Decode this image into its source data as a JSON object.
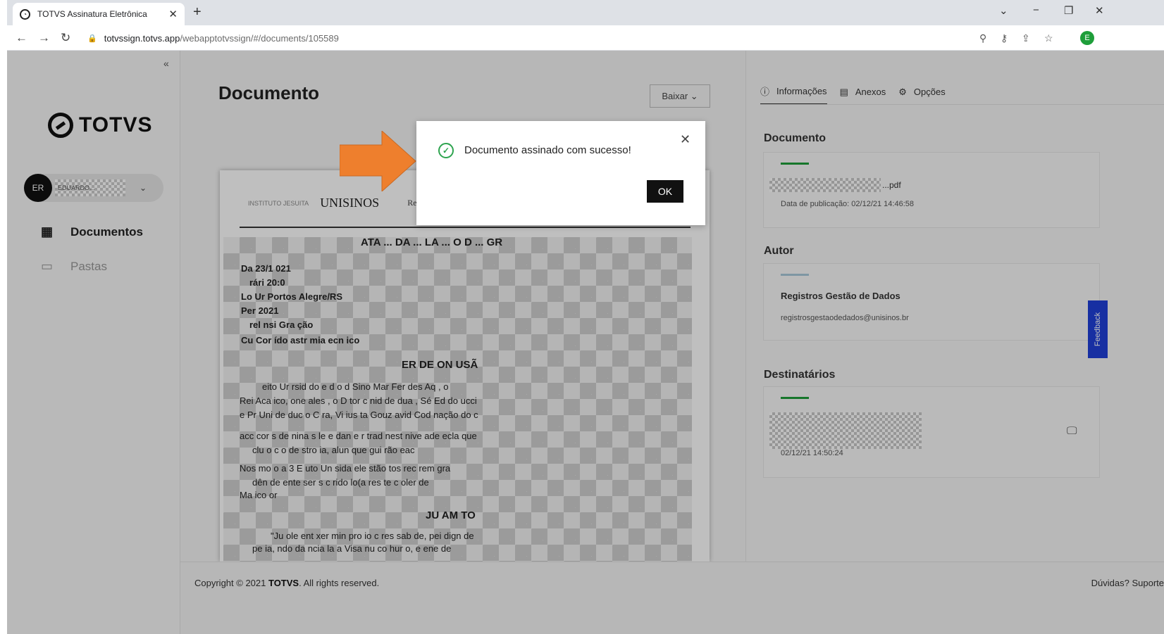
{
  "browser": {
    "tab_title": "TOTVS Assinatura Eletrônica",
    "tab_close": "✕",
    "new_tab": "+",
    "url_host": "totvssign.totvs.app",
    "url_path": "/webapptotvssign/#/documents/105589",
    "profile_initial": "E"
  },
  "sidebar": {
    "collapse": "«",
    "logo_text": "TOTVS",
    "user_initials": "ER",
    "username": "EDUARDO...",
    "menu": [
      {
        "label": "Documentos",
        "icon": "grid-icon"
      },
      {
        "label": "Pastas",
        "icon": "folder-icon"
      }
    ]
  },
  "main": {
    "title": "Documento",
    "download_label": "Baixar ⌄",
    "document": {
      "logo_small": "INSTITUTO JESUITA",
      "logo_main": "UNISINOS",
      "header_fragment": "Re",
      "lines": [
        "ATA ... DA ... LA ... O D ... GR",
        "Da   23/1  021",
        "rári   20:0",
        "Lo   Ur   Portos Alegre/RS",
        "Per      2021",
        "rel    nsi   Gra   ção",
        "Cu    Cor   ído   astr   mia   ecn   ico",
        "ER   DE   ON   USÃ",
        "eito   Ur   rsid   do   e d   o d   Sino   Mar   Fer   des   Aq   , o",
        "Rei   Aca   ico,   one   ales   , o D   tor c   nid   de   dua   , Sé   Ed   do   ucci",
        "e Pr   Uni   de   duc   o C   ra,   Vi   ius   ta   Gouz   avid   Cod   nação   do c",
        "acc   cor   s de   nina   s le   e   dan   e r   trad   nest   nive   ade   ecla   que",
        "clu   o c   o de   stro   ia,   alun   que   gui   rão   eac",
        "Nos   mo   o a   3   E   uto   Un   sida   ele   stão   tos   rec   rem   gra",
        "dên   de   ente   ser   s c   rido   lo(a   res   te c   oler   de",
        "Ma   ico   or",
        "JU   AM   TO",
        "\"Ju   ole   ent   xer   min   pro   io c   res   sab   de,   pei   dign   de",
        "pe   ia,   ndo   da   ncia   la a   Visa   nu   co   hur   o, e   ene   de"
      ]
    }
  },
  "right_panel": {
    "tabs": [
      {
        "label": "Informações",
        "icon": "info-icon"
      },
      {
        "label": "Anexos",
        "icon": "file-icon"
      },
      {
        "label": "Opções",
        "icon": "gear-icon"
      }
    ],
    "documento": {
      "title": "Documento",
      "filename": "...pdf",
      "publication": "Data de publicação: 02/12/21 14:46:58"
    },
    "autor": {
      "title": "Autor",
      "name": "Registros Gestão de Dados",
      "email": "registrosgestaodedados@unisinos.br"
    },
    "destinatarios": {
      "title": "Destinatários",
      "timestamp": "02/12/21 14:50:24"
    },
    "feedback": "Feedback"
  },
  "footer": {
    "copyright_prefix": "Copyright © 2021 ",
    "brand": "TOTVS",
    "copyright_suffix": ". All rights reserved.",
    "links": "Dúvidas?  Suporte"
  },
  "modal": {
    "message": "Documento assinado com sucesso!",
    "close": "✕",
    "ok_label": "OK"
  },
  "colors": {
    "success": "#2ea44f",
    "accent_green": "#1e9e3a",
    "author_bar": "#a9c8da",
    "feedback": "#1f3fd8",
    "arrow": "#ee7f2d"
  }
}
